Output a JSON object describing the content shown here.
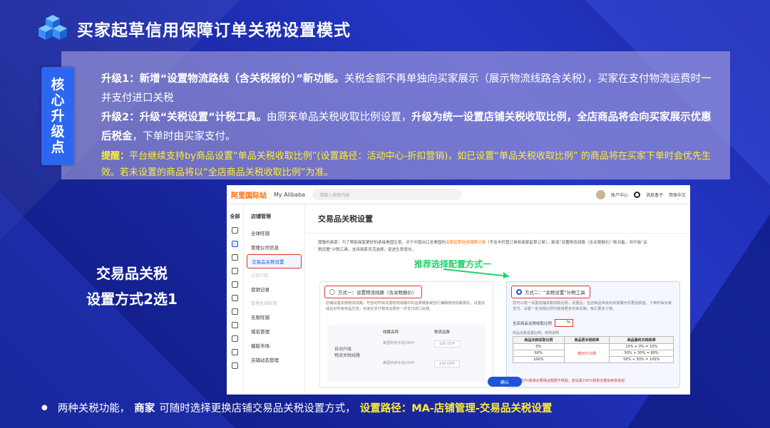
{
  "slide": {
    "title": "买家起草信用保障订单关税设置模式",
    "core_tag": [
      "核",
      "心",
      "升",
      "级",
      "点"
    ],
    "upgrade1_head": "升级1：新增“设置物流路线（含关税报价）”新功能。",
    "upgrade1_body": "关税金额不再单独向买家展示（展示物流线路含关税），买家在支付物流运费时一并支付进口关税",
    "upgrade2_head": "升级2：升级“关税设置”计税工具。",
    "upgrade2_mid": "由原来单品关税收取比例设置，",
    "upgrade2_bold": "升级为统一设置店铺关税收取比例，全店商品将会向买家展示优惠后税金",
    "upgrade2_tail": "，下单时由买家支付。",
    "tip_head": "提醒：",
    "tip_body": "平台继续支持by商品设置“单品关税收取比例”(设置路径：活动中心-折扣营销)，如已设置“单品关税收取比例” 的商品将在买家下单时会优先生效。若未设置的商品将以“全店商品关税收取比例”为准。",
    "left_label_1": "交易品关税",
    "left_label_2": "设置方式2选1",
    "recommend": "推荐选择配置方式一",
    "bullet_a": "两种关税功能，",
    "bullet_b": "商家",
    "bullet_c": "可随时选择更换店铺交易品关税设置方式，",
    "bullet_d": "设置路径：MA-店铺管理-交易品关税设置"
  },
  "screenshot": {
    "logo": "阿里国际站",
    "my_alibaba": "My Alibaba",
    "search_placeholder": "请输入搜索内容",
    "account": "账户中心",
    "message": "消息盒子",
    "language": "简体中文",
    "rail_top": "全部",
    "nav_group": "店铺管理",
    "nav_items": [
      "全球旺铺",
      "管理公司信息",
      "交易品关税设置"
    ],
    "nav_sub1": "公司介绍",
    "nav_items2": [
      "营销记录"
    ],
    "nav_sub2": "管理全球旺铺",
    "nav_items3": [
      "无限旺铺",
      "域名管理",
      "模版市场",
      "店铺动态管理"
    ],
    "page_title": "交易品关税设置",
    "intro_a": "尊敬的商家：为了帮助商家更好的承接美国生意，对于中国出口至美国的",
    "intro_b": "买家起草信用保障订单",
    "intro_c": "（不含半托管订单和商家起草订单），新增“设置物流线路（含关税报价）”新功能，并升级“关税设置”计税工具，支持商家灵活选择，促进生意增长。",
    "opt1_label": "方式一：设置物流线路（含关税报价）",
    "opt1_desc": "店铺设置关税物流线路，可自动开启设置物流线路中的运费模板或自行编辑物流线路报价。设置完成后对所有商品生效，买家在支付物流运费时一并支付进口关税。",
    "opt1_lab": "自动升级\n物流关税线路",
    "opt1_col1": "线路名称",
    "opt1_col2": "物流运费",
    "opt1_rows": [
      "美国物流专线(DDP)",
      "美国快递专线(DDP)"
    ],
    "opt1_vals": [
      "$30 DDP",
      "$30 DDP"
    ],
    "opt2_label": "方式二：“关税设置”计税工具",
    "opt2_desc": "您可以统一设置店铺关税收取比例，设置后，全店商品将会向买家展示优惠后税金，下单时由买家支付。设置一定关税比例可获得更多买家青睐，吸引更多订单。",
    "rate_label": "全店商品关税收取比例",
    "rate_value": "%",
    "ex_title": "商品关税设置比例，举例说明",
    "ex_headers": [
      "商品关税收取比例",
      "商品原关税税率",
      "商品最终关税税率"
    ],
    "ex_rows": [
      [
        "0%",
        "",
        "10% + 0% = 10%"
      ],
      [
        "60%",
        "按50%为例",
        "50% + 30% = 80%"
      ],
      [
        "100%",
        "",
        "50% + 50% = 100%"
      ]
    ],
    "foot_note": "若设置0%税率必要保证税额不收取，若设置100%税率全额由卖家承担",
    "confirm": "确认"
  }
}
